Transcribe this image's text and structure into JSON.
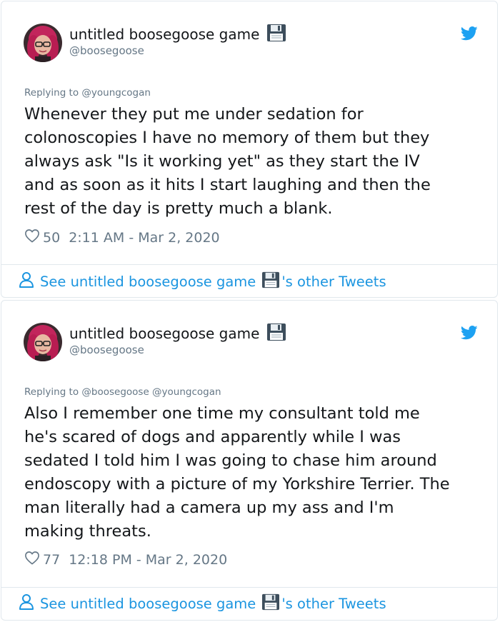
{
  "tweets": [
    {
      "display_name": "untitled boosegoose game",
      "handle": "@boosegoose",
      "replying_to": "Replying to @youngcogan",
      "lines": [
        "Whenever they put me under sedation for",
        "colonoscopies I have no memory of them but they",
        "always ask \"Is it working yet\" as they start the IV",
        "and as soon as it hits I start laughing and then the",
        "rest of the day is pretty much a blank."
      ],
      "likes": "50",
      "timestamp": "2:11 AM - Mar 2, 2020",
      "footer_prefix": "See untitled boosegoose game",
      "footer_suffix": "'s other Tweets"
    },
    {
      "display_name": "untitled boosegoose game",
      "handle": "@boosegoose",
      "replying_to": "Replying to @boosegoose @youngcogan",
      "lines": [
        "Also I remember one time my consultant told me",
        "he's scared of dogs and apparently while I was",
        "sedated I told him I was going to chase him around",
        "endoscopy with a picture of my Yorkshire Terrier. The",
        "man literally had a camera up my ass and I'm",
        "making threats."
      ],
      "likes": "77",
      "timestamp": "12:18 PM - Mar 2, 2020",
      "footer_prefix": "See untitled boosegoose game",
      "footer_suffix": "'s other Tweets"
    }
  ],
  "colors": {
    "text": "#14171a",
    "secondary": "#657786",
    "link": "#1b95e0",
    "twitter_blue": "#1da1f2",
    "border": "#e1e8ed"
  },
  "icons": {
    "bird": "twitter-bird-icon",
    "floppy": "floppy-disk-icon",
    "heart": "heart-outline-icon",
    "person": "person-outline-icon"
  }
}
